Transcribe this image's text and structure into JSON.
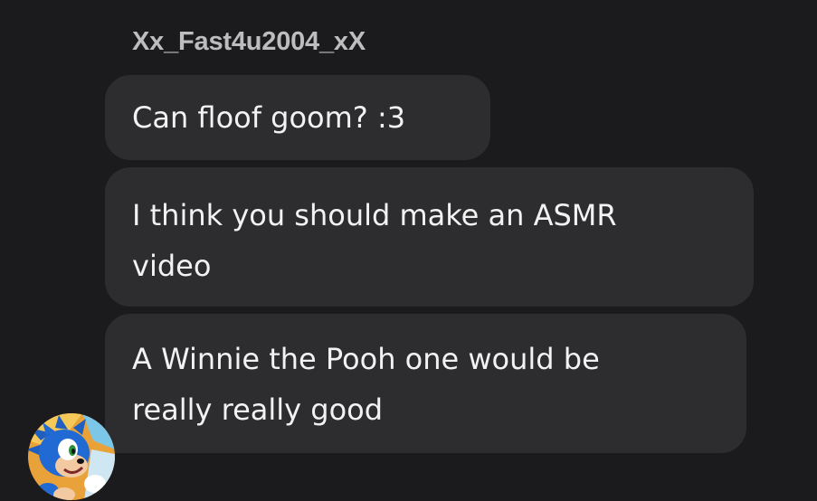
{
  "conversation": {
    "sender_name": "Xx_Fast4u2004_xX",
    "messages": [
      {
        "text": "Can floof goom? :3"
      },
      {
        "text": "I think you should make an ASMR\nvideo"
      },
      {
        "text": "A Winnie the Pooh one would be\nreally really good"
      }
    ],
    "avatar_icon": "sonic-hedgehog-avatar"
  },
  "colors": {
    "background": "#1b1b1d",
    "bubble": "#2d2d30",
    "message_text": "#f2f2f2",
    "sender_text": "#bdbdbf"
  }
}
